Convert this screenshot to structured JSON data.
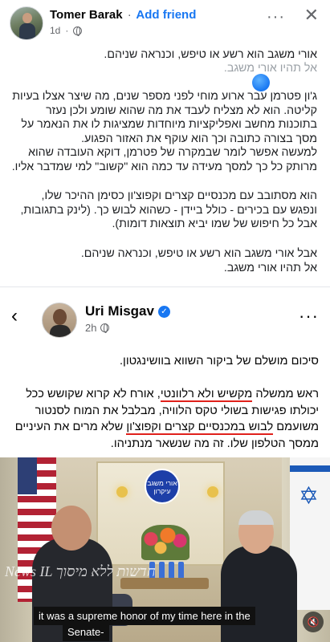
{
  "outer_post": {
    "author": "Tomer Barak",
    "separator": "·",
    "add_friend": "Add friend",
    "time": "1d",
    "more": "···",
    "close": "✕",
    "paragraphs": [
      "אורי משגב הוא רשע או טיפש, וכנראה שניהם.",
      "אל תהיו אורי משגב.",
      "ג'ון פטרמן עבר ארוע מוחי לפני מספר שנים, מה שיצר אצלו בעיות קליטה. הוא לא מצליח לעבד את מה שהוא שומע ולכן נעזר בתוכנות מחשב ואפליקציות מיוחדות שמציגות לו את הנאמר על מסך בצורה כתובה וכך הוא עוקף את האזור הפגוע.",
      "למעשה אפשר לומר שבמקרה של פטרמן, דוקא העובדה שהוא מרותק כל כך למסך מעידה עד כמה הוא \"קשוב\" למי שמדבר אליו.",
      "הוא מסתובב עם מכנסיים קצרים וקפוצ'ון כסימן ההיכר שלו, ונפגש עם בכירים - כולל ביידן - כשהוא לבוש כך. (לינק בתגובות, אבל כל חיפוש של שמו יביא תוצאות דומות).",
      "אבל אורי משגב הוא רשע או טיפש, וכנראה שניהם.",
      "אל תהיו אורי משגב."
    ]
  },
  "inner_post": {
    "author": "Uri Misgav",
    "verified": "✓",
    "time": "2h",
    "more": "···",
    "back": "‹",
    "line1": "סיכום מושלם של ביקור השווא בוושינגטון.",
    "p2_part1": "ראש ממשלה ",
    "p2_ul1": "מקשיש ולא רלוונטי",
    "p2_part2": ", אורח לא קרוא שקושש ככל יכולתו פגישות בשולי טקס הלוויה, מבלבל את המוח לסנטור משועמם ",
    "p2_ul2": "לבוש במכנסיים קצרים וקפוצ'ון",
    "p2_part3": " שלא מרים את העיניים ממסך הטלפון שלו. זה מה שנשאר מנתניהו."
  },
  "video": {
    "logo_line1": "אורי משגב",
    "logo_line2": "עיקרון",
    "watermark": "News IL חדשות ללא מיסוך",
    "subtitle_line1": "it was a supreme honor of my time here in the",
    "subtitle_line2": "Senate-",
    "mute_icon": "🔇"
  }
}
